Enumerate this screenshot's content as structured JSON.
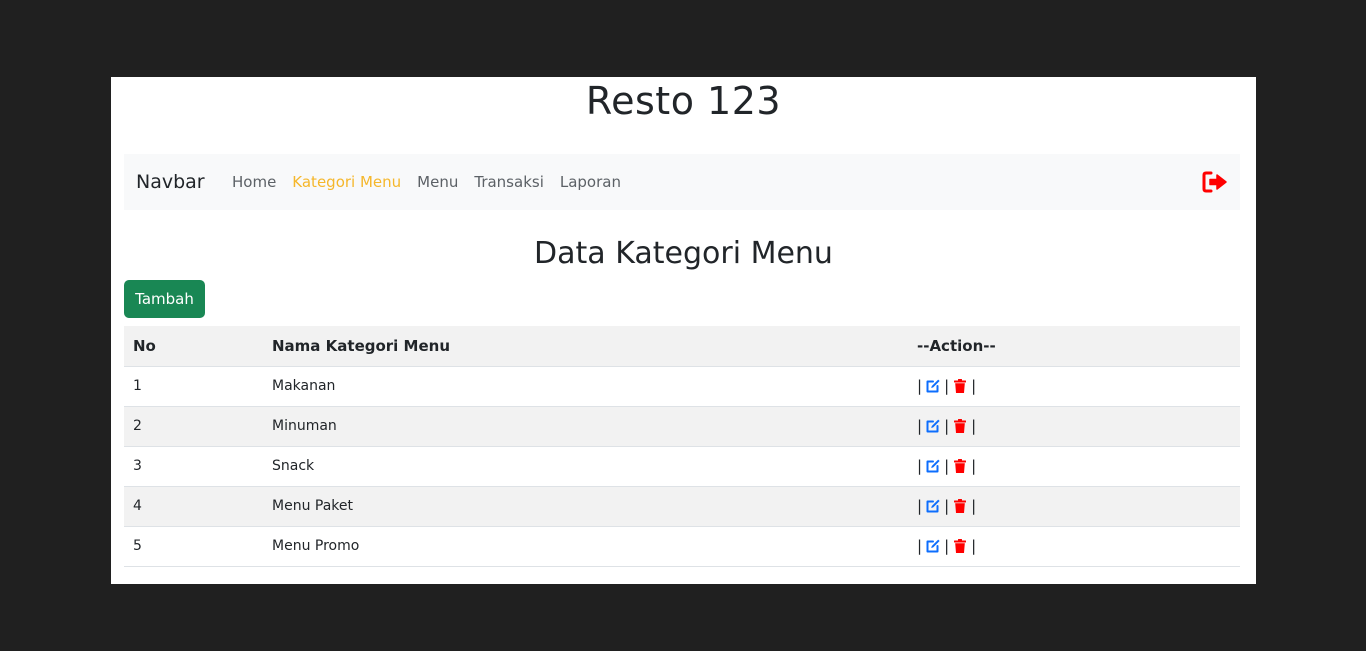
{
  "site": {
    "title": "Resto 123"
  },
  "navbar": {
    "brand": "Navbar",
    "links": [
      {
        "label": "Home",
        "active": false
      },
      {
        "label": "Kategori Menu",
        "active": true
      },
      {
        "label": "Menu",
        "active": false
      },
      {
        "label": "Transaksi",
        "active": false
      },
      {
        "label": "Laporan",
        "active": false
      }
    ],
    "logout_icon": "sign-out-icon"
  },
  "page": {
    "heading": "Data Kategori Menu",
    "add_button": "Tambah"
  },
  "table": {
    "headers": [
      "No",
      "Nama Kategori Menu",
      "--Action--"
    ],
    "action_separator": "|",
    "rows": [
      {
        "no": "1",
        "name": "Makanan"
      },
      {
        "no": "2",
        "name": "Minuman"
      },
      {
        "no": "3",
        "name": "Snack"
      },
      {
        "no": "4",
        "name": "Menu Paket"
      },
      {
        "no": "5",
        "name": "Menu Promo"
      }
    ]
  },
  "colors": {
    "background": "#202020",
    "active_link": "#f5b72b",
    "add_button": "#198754",
    "edit_icon": "#0d6efd",
    "delete_icon": "#ff0000",
    "logout_icon": "#ff0000"
  }
}
